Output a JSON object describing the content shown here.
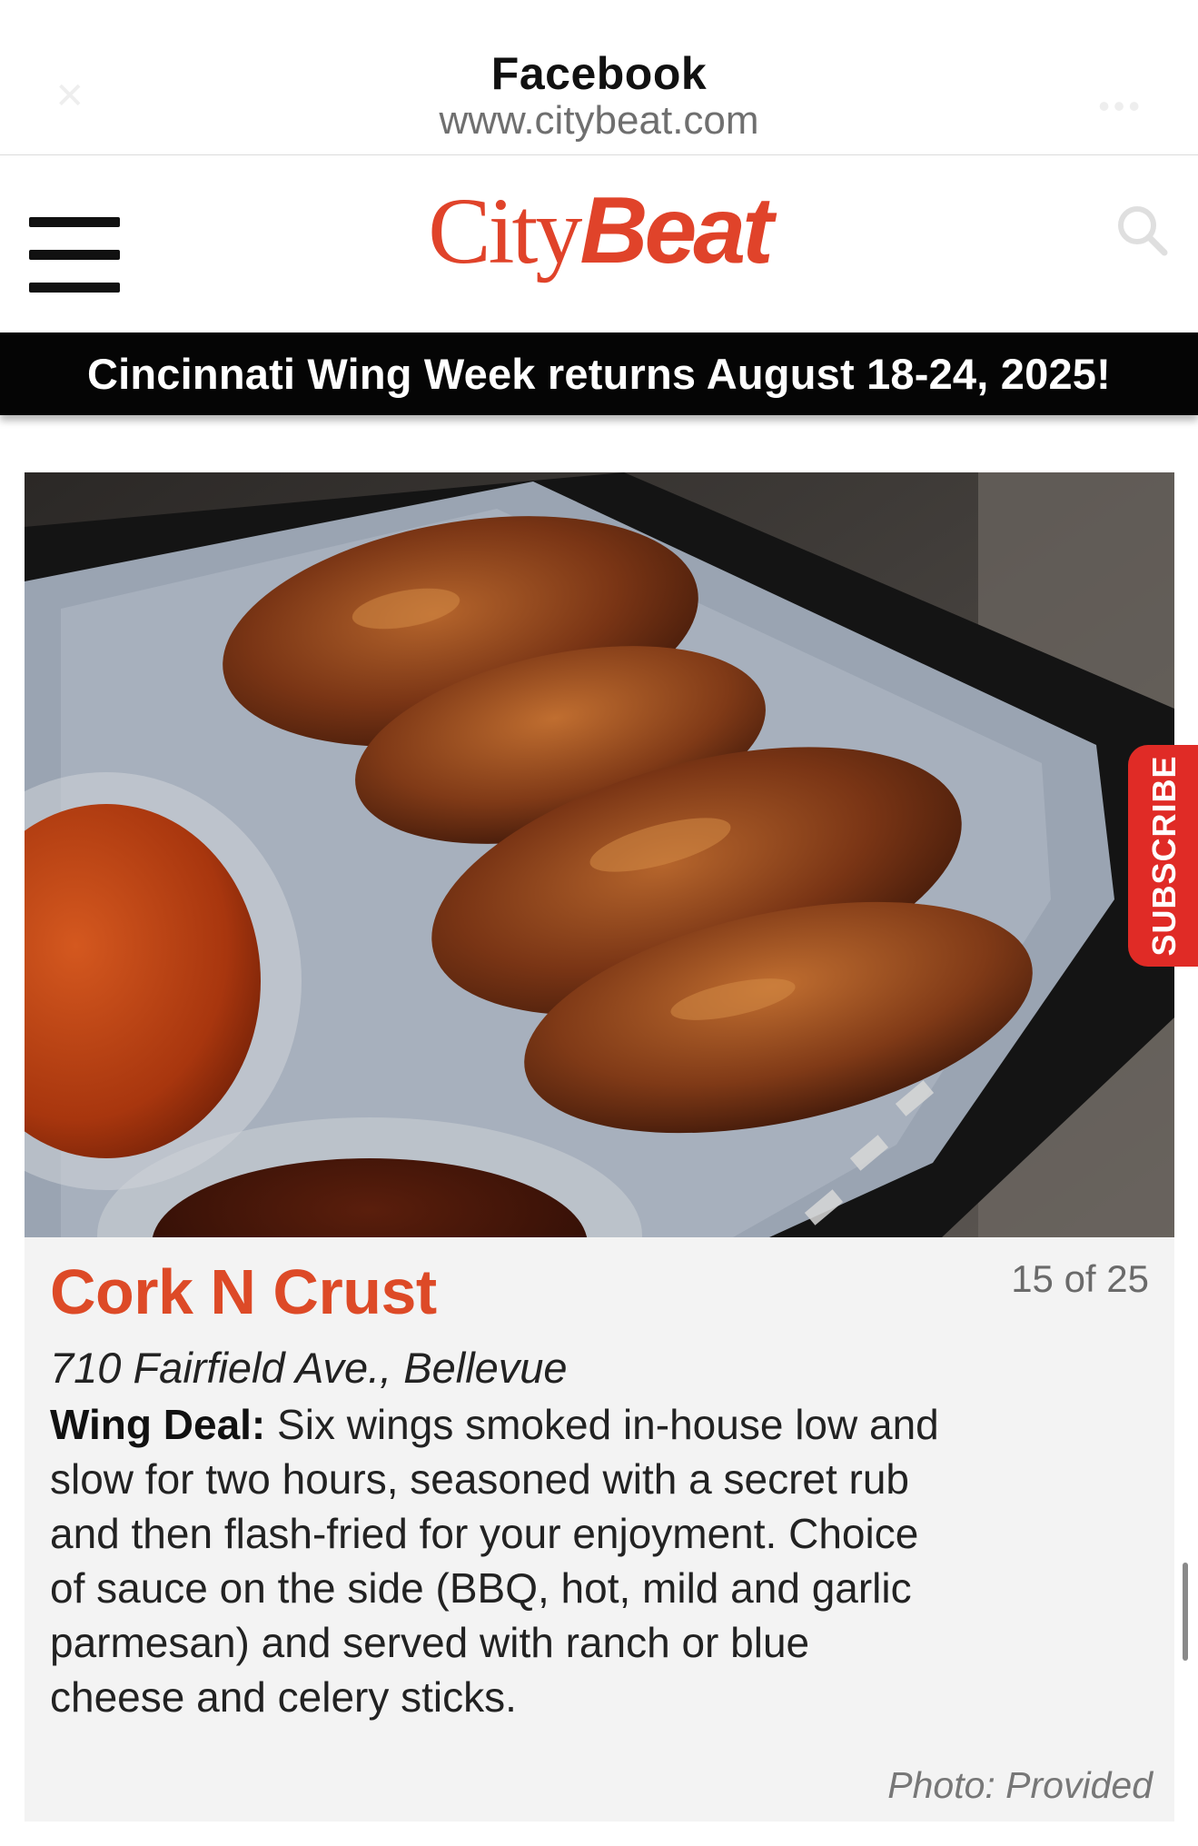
{
  "browser": {
    "title": "Facebook",
    "url": "www.citybeat.com"
  },
  "site": {
    "logo_part1": "City",
    "logo_part2": "Beat",
    "brand_color": "#e0432a"
  },
  "banner": {
    "text": "Cincinnati Wing Week returns August 18-24, 2025!"
  },
  "gallery": {
    "counter": "15 of 25",
    "item": {
      "name": "Cork N Crust",
      "address": "710 Fairfield Ave., Bellevue",
      "deal_label": "Wing Deal:",
      "deal_text": " Six wings smoked in-house low and slow for two hours, seasoned with a secret rub and then flash-fried for your enjoyment. Choice of sauce on the side (BBQ, hot, mild and garlic parmesan) and served with ranch or blue cheese and celery sticks.",
      "photo_credit": "Photo: Provided"
    }
  },
  "subscribe": {
    "label": "SUBSCRIBE",
    "color": "#e02b26"
  },
  "icons": {
    "menu": "hamburger-menu-icon",
    "search": "search-icon"
  }
}
